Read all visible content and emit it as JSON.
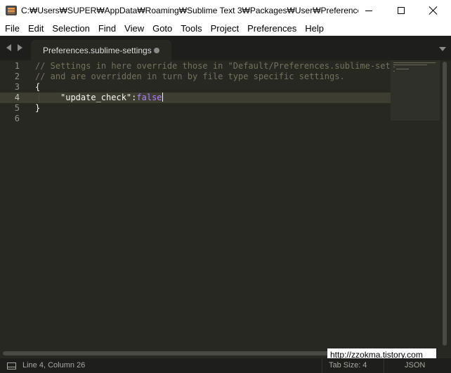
{
  "window": {
    "title": "C:₩Users₩SUPER₩AppData₩Roaming₩Sublime Text 3₩Packages₩User₩Preferences.s...",
    "buttons": [
      "minimize-icon",
      "maximize-icon",
      "close-icon"
    ]
  },
  "menubar": {
    "items": [
      "File",
      "Edit",
      "Selection",
      "Find",
      "View",
      "Goto",
      "Tools",
      "Project",
      "Preferences",
      "Help"
    ]
  },
  "tabs": [
    {
      "label": "Preferences.sublime-settings",
      "modified": true
    }
  ],
  "editor": {
    "line_numbers": [
      "1",
      "2",
      "3",
      "4",
      "5",
      "6"
    ],
    "active_line": 4,
    "lines": {
      "l1": "// Settings in here override those in \"Default/Preferences.sublime-settings\",",
      "l2": "// and are overridden in turn by file type specific settings.",
      "l3": "{",
      "l4_key": "\"update_check\"",
      "l4_colon": ":",
      "l4_value": "false",
      "l5": "}"
    },
    "colors": {
      "background": "#272822",
      "comment": "#75715e",
      "constant": "#ae81ff",
      "text": "#f8f8f2"
    }
  },
  "watermark": "http://zzokma.tistory.com",
  "statusbar": {
    "position": "Line 4, Column 26",
    "tab_size": "Tab Size: 4",
    "syntax": "JSON"
  }
}
